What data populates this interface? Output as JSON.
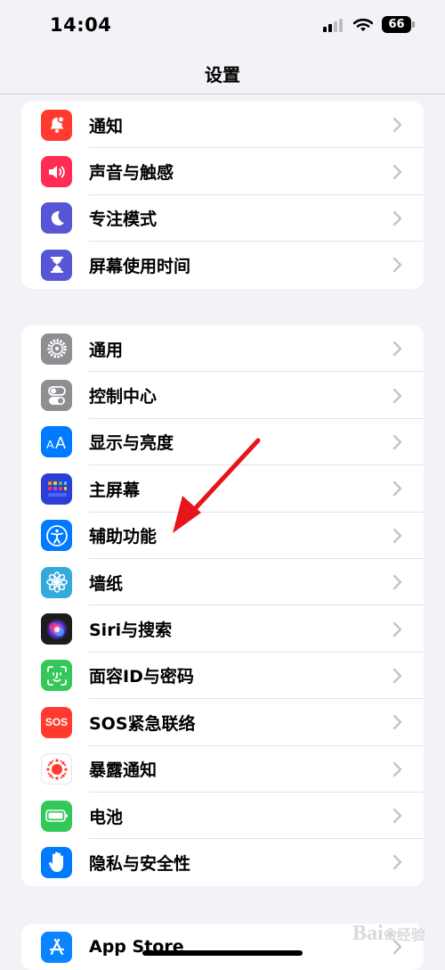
{
  "status_bar": {
    "time": "14:04",
    "battery_level": "66"
  },
  "nav": {
    "title": "设置"
  },
  "groups": [
    {
      "items": [
        {
          "label": "通知",
          "icon": "bell-icon",
          "color": "#ff3b30"
        },
        {
          "label": "声音与触感",
          "icon": "speaker-icon",
          "color": "#ff2d55"
        },
        {
          "label": "专注模式",
          "icon": "moon-icon",
          "color": "#5856d6"
        },
        {
          "label": "屏幕使用时间",
          "icon": "hourglass-icon",
          "color": "#5856d6"
        }
      ]
    },
    {
      "items": [
        {
          "label": "通用",
          "icon": "gear-icon",
          "color": "#8e8e93"
        },
        {
          "label": "控制中心",
          "icon": "toggles-icon",
          "color": "#8e8e93"
        },
        {
          "label": "显示与亮度",
          "icon": "text-size-icon",
          "color": "#007aff"
        },
        {
          "label": "主屏幕",
          "icon": "home-grid-icon",
          "color": "#2b3fd6"
        },
        {
          "label": "辅助功能",
          "icon": "accessibility-icon",
          "color": "#007aff"
        },
        {
          "label": "墙纸",
          "icon": "flower-icon",
          "color": "#34aadc"
        },
        {
          "label": "Siri与搜索",
          "icon": "siri-icon",
          "color": "#1c1c1e"
        },
        {
          "label": "面容ID与密码",
          "icon": "face-id-icon",
          "color": "#34c759"
        },
        {
          "label": "SOS紧急联络",
          "icon": "sos-icon",
          "color": "#ff3b30",
          "icon_text": "SOS"
        },
        {
          "label": "暴露通知",
          "icon": "exposure-icon",
          "color": "#ffffff"
        },
        {
          "label": "电池",
          "icon": "battery-icon",
          "color": "#34c759"
        },
        {
          "label": "隐私与安全性",
          "icon": "hand-icon",
          "color": "#007aff"
        }
      ]
    },
    {
      "items": [
        {
          "label": "App Store",
          "icon": "app-store-icon",
          "color": "#0a84ff"
        }
      ]
    }
  ],
  "watermark": {
    "brand": "Bai",
    "suffix": "经验"
  }
}
